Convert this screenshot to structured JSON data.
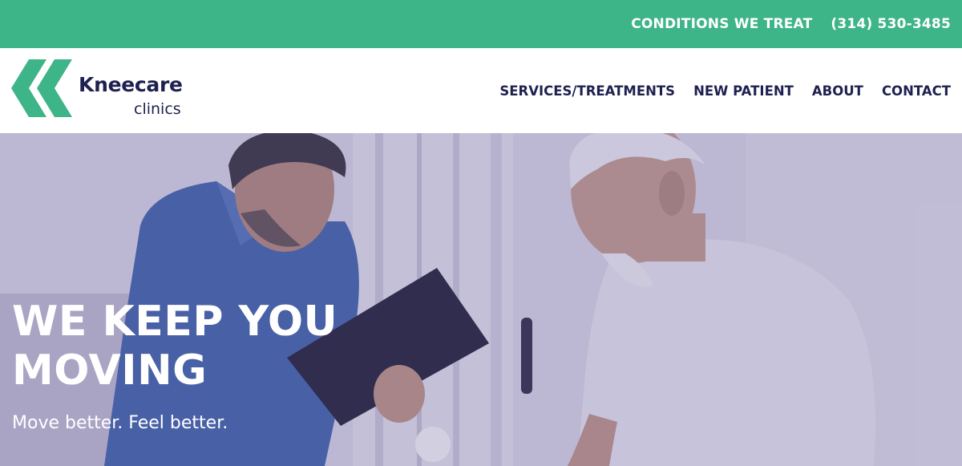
{
  "topbar": {
    "conditions_link": "CONDITIONS WE TREAT",
    "phone": "(314) 530-3485"
  },
  "brand": {
    "name": "Kneecare",
    "sub": "clinics",
    "colors": {
      "green": "#3eb489",
      "navy": "#1e2150"
    }
  },
  "nav": {
    "items": [
      {
        "label": "SERVICES/TREATMENTS"
      },
      {
        "label": "NEW PATIENT"
      },
      {
        "label": "ABOUT"
      },
      {
        "label": "CONTACT"
      }
    ]
  },
  "hero": {
    "title_line1": "WE KEEP YOU",
    "title_line2": "MOVING",
    "subtitle": "Move better. Feel better."
  }
}
